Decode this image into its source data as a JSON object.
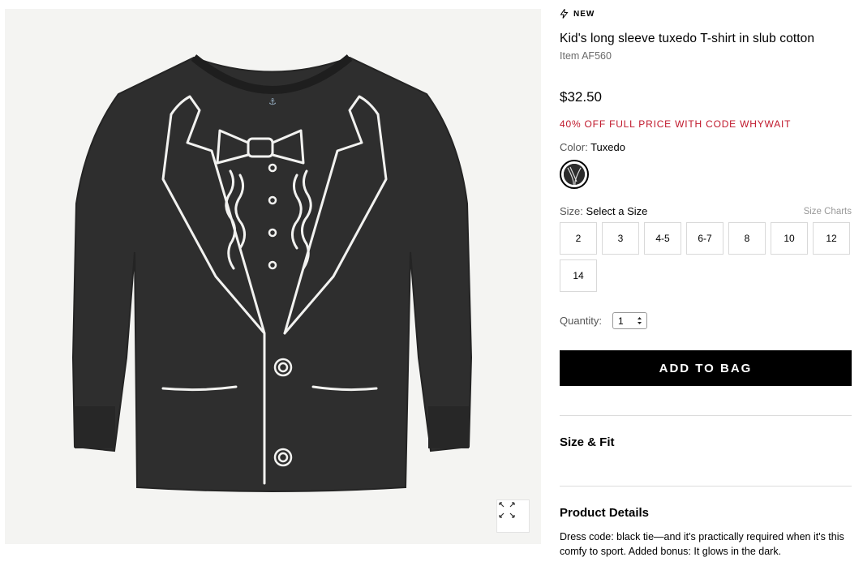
{
  "product_image": {
    "alt_icon": "tuxedo-tshirt-image",
    "zoom_icon": "expand-icon"
  },
  "badge": {
    "label": "NEW",
    "icon": "lightning-icon"
  },
  "title": "Kid's long sleeve tuxedo T-shirt in slub cotton",
  "item_number": "Item AF560",
  "price": "$32.50",
  "promo": "40% OFF FULL PRICE WITH CODE WHYWAIT",
  "color": {
    "label": "Color:",
    "value": "Tuxedo"
  },
  "size": {
    "label": "Size:",
    "value": "Select a Size",
    "charts_link": "Size Charts",
    "options": [
      "2",
      "3",
      "4-5",
      "6-7",
      "8",
      "10",
      "12",
      "14"
    ]
  },
  "quantity": {
    "label": "Quantity:",
    "value": "1"
  },
  "add_to_bag": "ADD TO BAG",
  "sections": {
    "size_fit": "Size & Fit",
    "product_details": "Product Details",
    "description": "Dress code: black tie—and it's practically required when it's this comfy to sport. Added bonus: It glows in the dark."
  },
  "colors": {
    "promo": "#c0182b",
    "button": "#000000",
    "shirt": "#2e2e2e"
  }
}
